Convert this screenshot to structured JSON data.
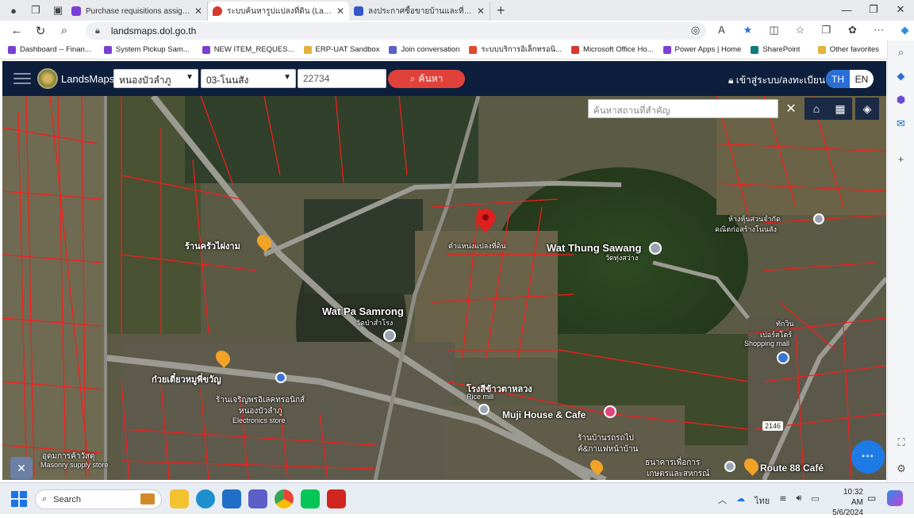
{
  "browser": {
    "tabs": [
      {
        "title": "Purchase requisitions assigned to",
        "color": "#7b3fd6"
      },
      {
        "title": "ระบบค้นหารูปแปลงที่ดิน (LandsMaps",
        "color": "#d9382f",
        "active": true
      },
      {
        "title": "ลงประกาศซื้อขายบ้านและที่ดินฟรี! | ที่",
        "color": "#3458c9"
      }
    ],
    "url": "landsmaps.dol.go.th",
    "bookmarks": [
      {
        "label": "Dashboard -- Finan...",
        "color": "#7b3fd6"
      },
      {
        "label": "System Pickup Sam...",
        "color": "#7b3fd6"
      },
      {
        "label": "NEW ITEM_REQUES...",
        "color": "#7b3fd6"
      },
      {
        "label": "ERP-UAT Sandbox",
        "color": "#e2b33c"
      },
      {
        "label": "Join conversation",
        "color": "#5b5fc7"
      },
      {
        "label": "ระบบบริการอิเล็กทรอนิ...",
        "color": "#e34a2b"
      },
      {
        "label": "Microsoft Office Ho...",
        "color": "#d9382f"
      },
      {
        "label": "Power Apps | Home",
        "color": "#7b3fd6"
      },
      {
        "label": "SharePoint",
        "color": "#0f7b7b"
      }
    ],
    "other_favorites": "Other favorites"
  },
  "app": {
    "brand": "LandsMaps",
    "province": "หนองบัวลำภู",
    "district": "03-โนนสัง",
    "parcel_no": "22734",
    "search_label": "ค้นหา",
    "login_label": "เข้าสู่ระบบ/ลงทะเบียน",
    "lang_th": "TH",
    "lang_en": "EN",
    "place_search_placeholder": "ค้นหาสถานที่สำคัญ"
  },
  "map": {
    "labels": {
      "parcel_pin": "ตำแหน่งแปลงที่ดิน",
      "wat_thung_sawang": "Wat Thung Sawang",
      "wat_thung_sawang_th": "วัดทุ่งสว่าง",
      "wat_pa_samrong": "Wat Pa Samrong",
      "wat_pa_samrong_th": "วัดป่าสำโรง",
      "restaurant": "ร้านครัวไผ่งาม",
      "partnership": "ห้างหุ้นส่วนจำกัด",
      "partnership_2": "คณิตก่อสร้างโนนสัง",
      "shopping_1": "ทักวิน",
      "shopping_2": "เปอร์สโตร์",
      "shopping_en": "Shopping mall",
      "noodle": "ก๋วยเตี๋ยวหมูพี่ขวัญ",
      "electronics_th_1": "ร้านเจริญพรอิเลคทรอนิกส์",
      "electronics_th_2": "หนองบัวลำภู",
      "electronics_en": "Electronics store",
      "rice_mill_th": "โรงสีข้าวตาหลวง",
      "rice_mill_en": "Rice mill",
      "muji": "Muji House & Cafe",
      "cafe_th_1": "ร้านบ้านรถรถไป",
      "cafe_th_2": "ค์&กาแฟหน้าบ้าน",
      "bank_1": "ธนาคารเพื่อการ",
      "bank_2": "เกษตรและสหกรณ์",
      "masonry_th": "อุดมการค้าวัสดุ",
      "masonry_en": "Masonry supply store",
      "route": "Route 88 Café",
      "road_no": "2146"
    }
  },
  "taskbar": {
    "search_label": "Search",
    "lang": "ไทย",
    "time": "10:32 AM",
    "date": "5/6/2024"
  }
}
